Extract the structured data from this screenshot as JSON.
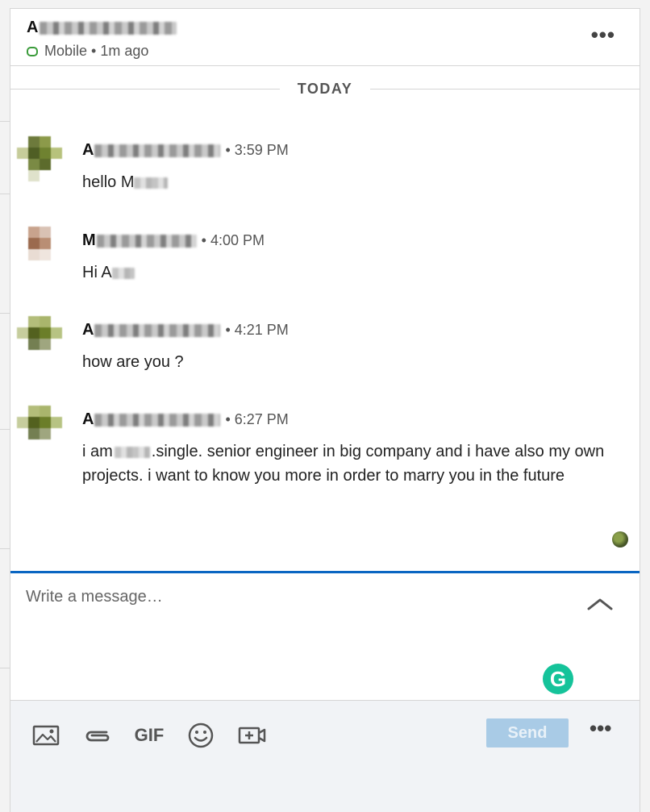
{
  "header": {
    "contact_initial": "A",
    "presence": "Mobile",
    "last_seen": "1m ago",
    "more_label": "•••"
  },
  "divider": {
    "label": "TODAY"
  },
  "messages": [
    {
      "sender_initial": "A",
      "time": "• 3:59 PM",
      "text_prefix": "hello M",
      "text_suffix": ""
    },
    {
      "sender_initial": "M",
      "time": "• 4:00 PM",
      "text_prefix": "Hi A",
      "text_suffix": ""
    },
    {
      "sender_initial": "A",
      "time": "• 4:21 PM",
      "text_prefix": "how are you ?",
      "text_suffix": ""
    },
    {
      "sender_initial": "A",
      "time": "• 6:27 PM",
      "text_prefix": "i am",
      "text_suffix": ".single. senior engineer in big company and i have also my own projects. i want to know you more in order to marry you in the future"
    }
  ],
  "composer": {
    "placeholder": "Write a message…"
  },
  "grammarly": {
    "label": "G"
  },
  "toolbar": {
    "gif_label": "GIF",
    "send_label": "Send",
    "more_label": "•••"
  },
  "colors": {
    "accent": "#0a66c2",
    "send_disabled": "#a9cbe6",
    "presence": "#3a9b3a",
    "grammarly": "#15c39a"
  },
  "icons": [
    "image-icon",
    "attachment-icon",
    "gif-icon",
    "emoji-icon",
    "video-call-icon",
    "chevron-up-icon",
    "more-icon"
  ]
}
